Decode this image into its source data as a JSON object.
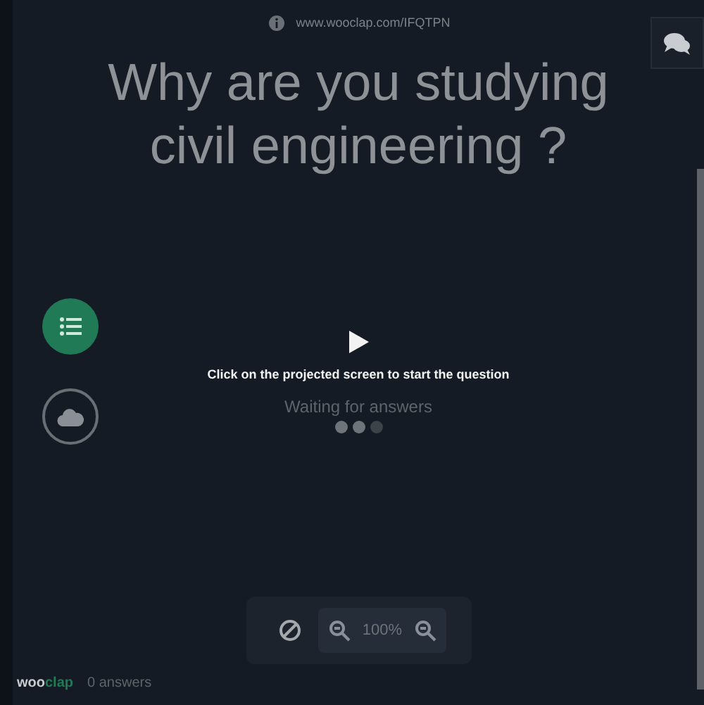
{
  "header": {
    "url": "www.wooclap.com/IFQTPN"
  },
  "question": {
    "title": "Why are you studying civil engineering ?"
  },
  "side_buttons": [
    {
      "kind": "list",
      "selected": true
    },
    {
      "kind": "cloud",
      "selected": false
    }
  ],
  "status": {
    "instruction": "Click on the projected screen to start the question",
    "waiting": "Waiting for answers"
  },
  "toolbar": {
    "zoom": "100%"
  },
  "footer": {
    "logo_main": "woo",
    "logo_accent": "clap",
    "answers": "0 answers"
  }
}
